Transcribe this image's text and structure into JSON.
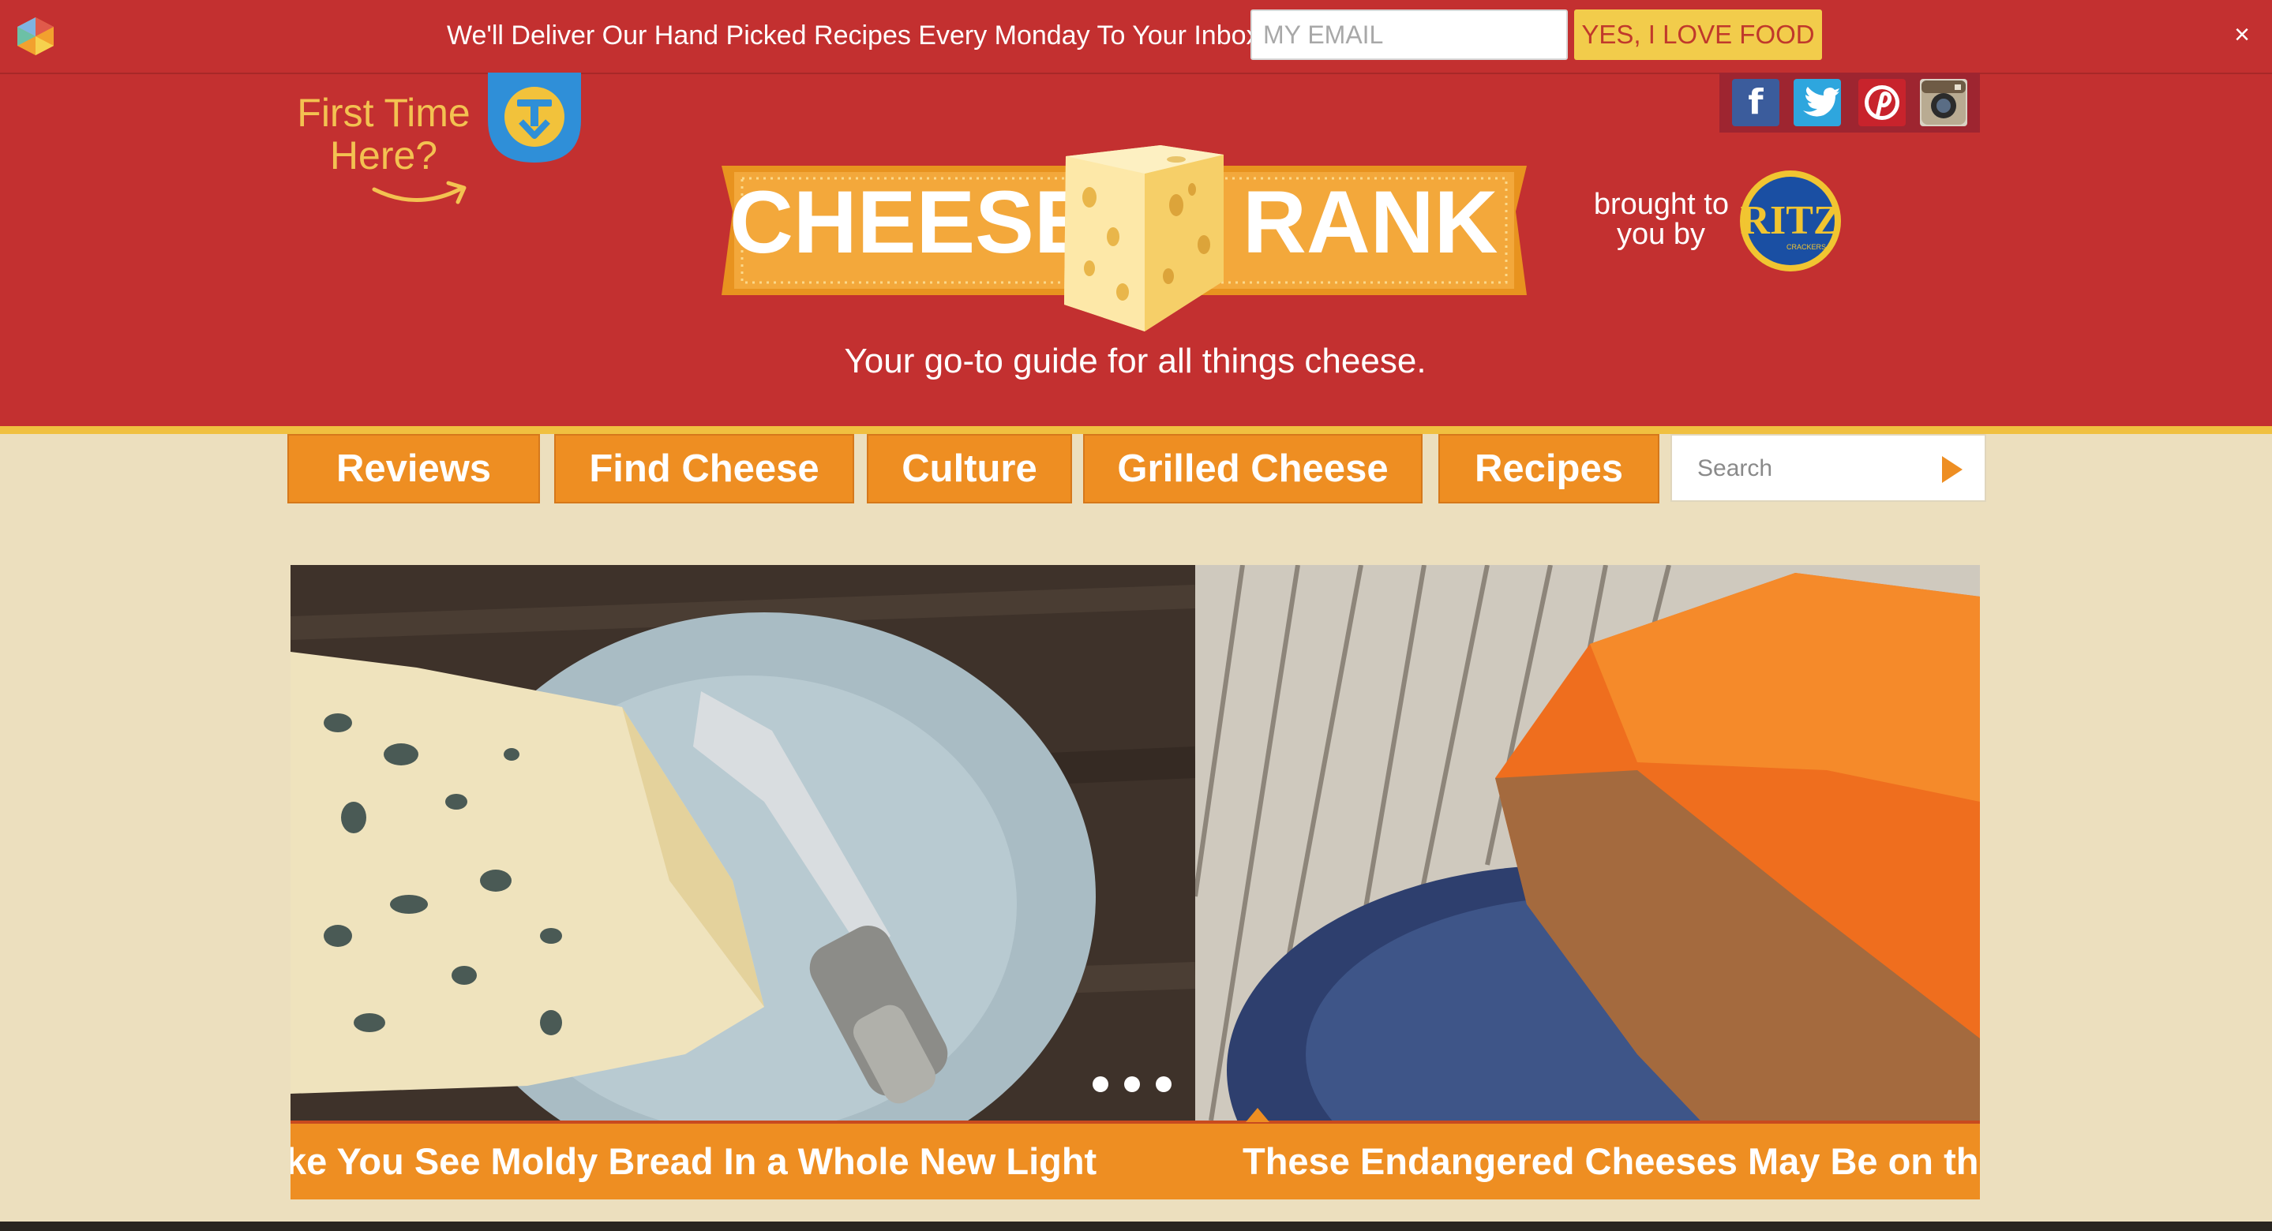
{
  "promo": {
    "text": "We'll Deliver Our Hand Picked Recipes Every Monday To Your Inbox",
    "email_placeholder": "MY EMAIL",
    "button": "YES, I LOVE FOOD",
    "close": "×"
  },
  "header": {
    "first_time_line1": "First Time",
    "first_time_line2": "Here?",
    "logo_left": "CHEESE",
    "logo_right": "RANK",
    "tagline": "Your go-to guide for all things cheese.",
    "brought_line1": "brought to",
    "brought_line2": "you by",
    "sponsor": "RITZ",
    "sponsor_sub": "CRACKERS"
  },
  "social": [
    "facebook-icon",
    "twitter-icon",
    "pinterest-icon",
    "instagram-icon"
  ],
  "nav": {
    "items": [
      "Reviews",
      "Find Cheese",
      "Culture",
      "Grilled Cheese",
      "Recipes"
    ],
    "search_placeholder": "Search"
  },
  "slider": {
    "captions": [
      "ke You See Moldy Bread In a Whole New Light",
      "These Endangered Cheeses May Be on the"
    ],
    "dots": 3
  },
  "colors": {
    "header_red": "#c33030",
    "nav_orange": "#ee8e22",
    "accent_yellow": "#f2cc4b",
    "page_beige": "#ecdfbe"
  }
}
